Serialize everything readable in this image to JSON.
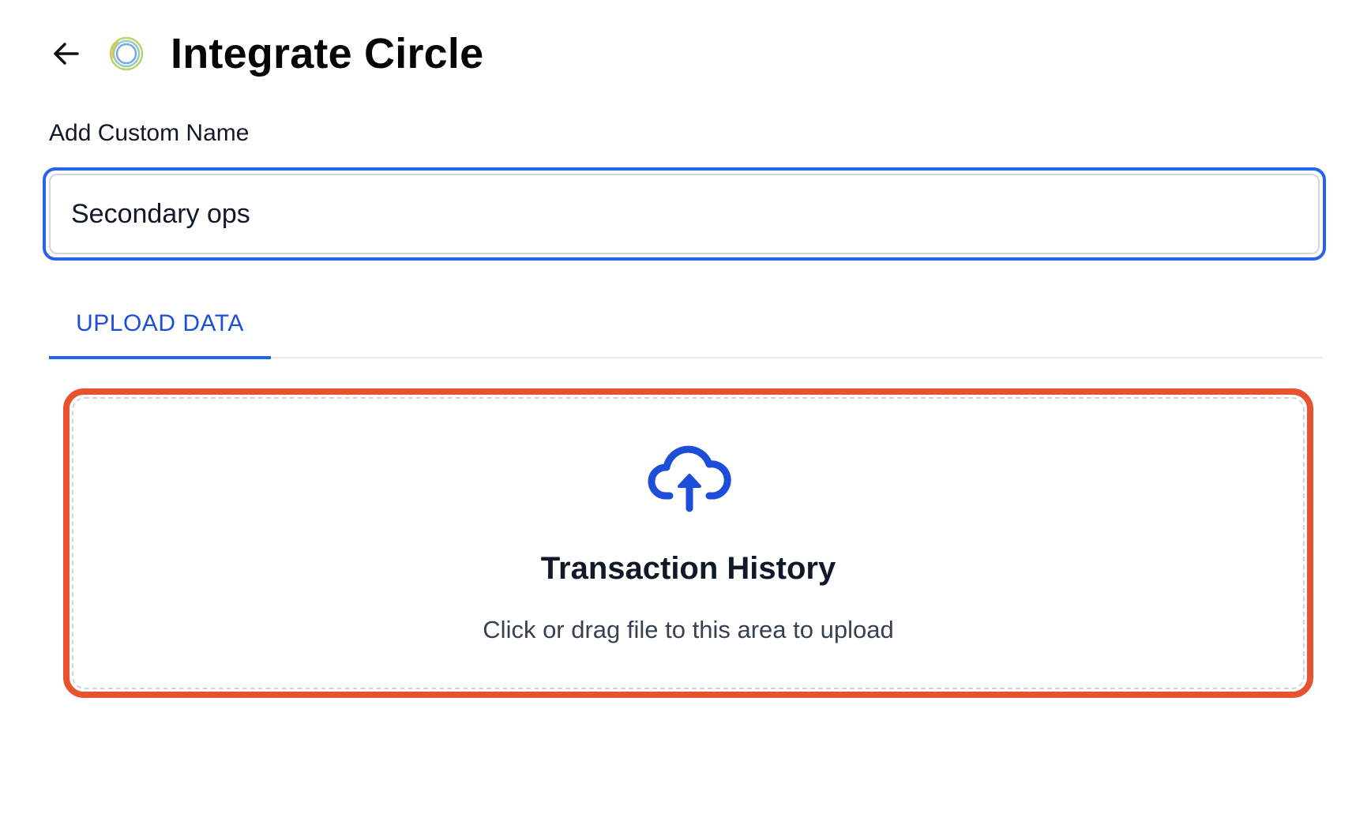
{
  "header": {
    "back_icon": "arrow-left-icon",
    "logo_icon": "circle-logo-icon",
    "title": "Integrate Circle"
  },
  "form": {
    "name_label": "Add Custom Name",
    "name_value": "Secondary ops"
  },
  "tabs": [
    {
      "label": "UPLOAD DATA",
      "active": true
    }
  ],
  "dropzone": {
    "icon": "cloud-upload-icon",
    "title": "Transaction History",
    "hint": "Click or drag file to this area to upload"
  },
  "colors": {
    "accent": "#2563eb",
    "highlight_border": "#e8522e"
  }
}
